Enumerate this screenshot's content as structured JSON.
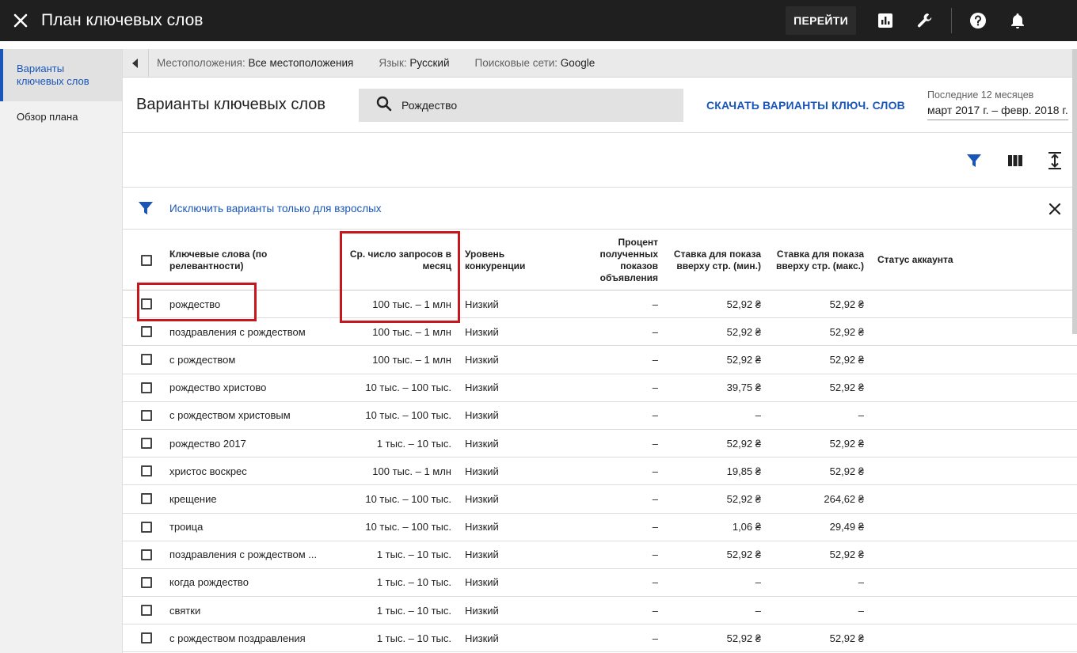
{
  "topbar": {
    "title": "План ключевых слов",
    "goto_label": "ПЕРЕЙТИ",
    "icons": [
      "close-icon",
      "bar-chart-icon",
      "wrench-icon",
      "help-icon",
      "bell-icon"
    ]
  },
  "sidebar": {
    "items": [
      {
        "label": "Варианты ключевых слов",
        "active": true
      },
      {
        "label": "Обзор плана",
        "active": false
      }
    ]
  },
  "filters": {
    "location_label": "Местоположения:",
    "location_value": "Все местоположения",
    "language_label": "Язык:",
    "language_value": "Русский",
    "network_label": "Поисковые сети:",
    "network_value": "Google"
  },
  "header": {
    "title": "Варианты ключевых слов",
    "search_value": "Рождество",
    "download_label": "СКАЧАТЬ ВАРИАНТЫ КЛЮЧ. СЛОВ",
    "period_label": "Последние 12 месяцев",
    "period_value": "март 2017 г. – февр. 2018 г."
  },
  "filter_chip": {
    "text": "Исключить варианты только для взрослых"
  },
  "table": {
    "columns": {
      "keyword": "Ключевые слова (по релевантности)",
      "avg": "Ср. число запросов в месяц",
      "competition": "Уровень конкуренции",
      "impr_pct": "Процент полученных показов объявления",
      "bid_min": "Ставка для показа вверху стр. (мин.)",
      "bid_max": "Ставка для показа вверху стр. (макс.)",
      "status": "Статус аккаунта"
    },
    "rows": [
      {
        "keyword": "рождество",
        "avg": "100 тыс. – 1 млн",
        "competition": "Низкий",
        "impr_pct": "–",
        "bid_min": "52,92 ₴",
        "bid_max": "52,92 ₴"
      },
      {
        "keyword": "поздравления с рождеством",
        "avg": "100 тыс. – 1 млн",
        "competition": "Низкий",
        "impr_pct": "–",
        "bid_min": "52,92 ₴",
        "bid_max": "52,92 ₴"
      },
      {
        "keyword": "с рождеством",
        "avg": "100 тыс. – 1 млн",
        "competition": "Низкий",
        "impr_pct": "–",
        "bid_min": "52,92 ₴",
        "bid_max": "52,92 ₴"
      },
      {
        "keyword": "рождество христово",
        "avg": "10 тыс. – 100 тыс.",
        "competition": "Низкий",
        "impr_pct": "–",
        "bid_min": "39,75 ₴",
        "bid_max": "52,92 ₴"
      },
      {
        "keyword": "с рождеством христовым",
        "avg": "10 тыс. – 100 тыс.",
        "competition": "Низкий",
        "impr_pct": "–",
        "bid_min": "–",
        "bid_max": "–"
      },
      {
        "keyword": "рождество 2017",
        "avg": "1 тыс. – 10 тыс.",
        "competition": "Низкий",
        "impr_pct": "–",
        "bid_min": "52,92 ₴",
        "bid_max": "52,92 ₴"
      },
      {
        "keyword": "христос воскрес",
        "avg": "100 тыс. – 1 млн",
        "competition": "Низкий",
        "impr_pct": "–",
        "bid_min": "19,85 ₴",
        "bid_max": "52,92 ₴"
      },
      {
        "keyword": "крещение",
        "avg": "10 тыс. – 100 тыс.",
        "competition": "Низкий",
        "impr_pct": "–",
        "bid_min": "52,92 ₴",
        "bid_max": "264,62 ₴"
      },
      {
        "keyword": "троица",
        "avg": "10 тыс. – 100 тыс.",
        "competition": "Низкий",
        "impr_pct": "–",
        "bid_min": "1,06 ₴",
        "bid_max": "29,49 ₴"
      },
      {
        "keyword": "поздравления с рождеством ...",
        "avg": "1 тыс. – 10 тыс.",
        "competition": "Низкий",
        "impr_pct": "–",
        "bid_min": "52,92 ₴",
        "bid_max": "52,92 ₴"
      },
      {
        "keyword": "когда рождество",
        "avg": "1 тыс. – 10 тыс.",
        "competition": "Низкий",
        "impr_pct": "–",
        "bid_min": "–",
        "bid_max": "–"
      },
      {
        "keyword": "святки",
        "avg": "1 тыс. – 10 тыс.",
        "competition": "Низкий",
        "impr_pct": "–",
        "bid_min": "–",
        "bid_max": "–"
      },
      {
        "keyword": "с рождеством поздравления",
        "avg": "1 тыс. – 10 тыс.",
        "competition": "Низкий",
        "impr_pct": "–",
        "bid_min": "52,92 ₴",
        "bid_max": "52,92 ₴"
      }
    ]
  },
  "colors": {
    "accent": "#1a56b8",
    "topbar": "#1f1f1f",
    "highlight": "#c8161d"
  }
}
